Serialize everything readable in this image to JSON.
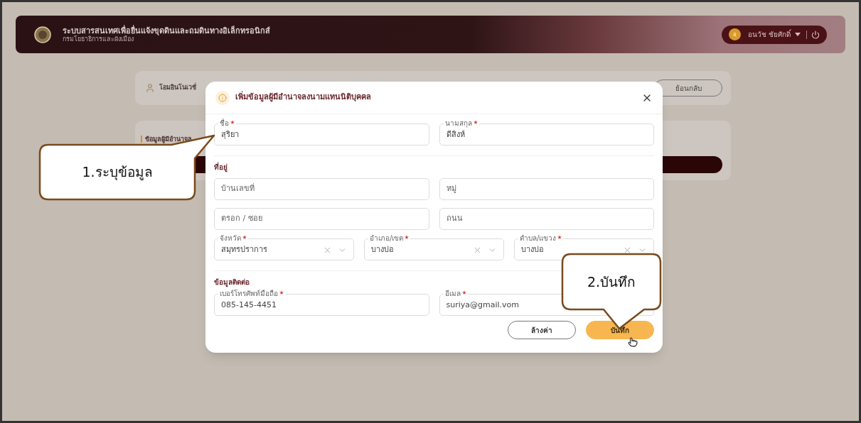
{
  "header": {
    "title": "ระบบสารสนเทศเพื่อยื่นแจ้งขุดดินและถมดินทางอิเล็กทรอนิกส์",
    "subtitle": "กรมโยธาธิการและผังเมือง",
    "user": {
      "initial": "อ",
      "name": "อนวัช ชัยศักดิ์"
    }
  },
  "company_card": {
    "name": "โอมอินโนเวชั่",
    "back_button": "ย้อนกลับ"
  },
  "section_card": {
    "title": "ข้อมูลผู้มีอำนาจล"
  },
  "dialog": {
    "title": "เพิ่มข้อมูลผู้มีอำนาจลงนามแทนนิติบุคคล",
    "name_fields": [
      {
        "label": "ชื่อ",
        "required": true,
        "value": "สุริยา"
      },
      {
        "label": "นามสกุล",
        "required": true,
        "value": "ดีสิงห์"
      }
    ],
    "address_title": "ที่อยู่",
    "address_fields": [
      {
        "placeholder": "บ้านเลขที่"
      },
      {
        "placeholder": "หมู่"
      },
      {
        "placeholder": "ตรอก / ซอย"
      },
      {
        "placeholder": "ถนน"
      }
    ],
    "location_selects": [
      {
        "label": "จังหวัด",
        "required": true,
        "value": "สมุทรปราการ"
      },
      {
        "label": "อำเภอ/เขต",
        "required": true,
        "value": "บางบ่อ"
      },
      {
        "label": "ตำบล/แขวง",
        "required": true,
        "value": "บางบ่อ"
      }
    ],
    "contact_title": "ข้อมูลติดต่อ",
    "contact_fields": [
      {
        "label": "เบอร์โทรศัพท์มือถือ",
        "required": true,
        "value": "085-145-4451"
      },
      {
        "label": "อีเมล",
        "required": true,
        "value": "suriya@gmail.vom"
      }
    ],
    "buttons": [
      {
        "label": "ล้างค่า",
        "kind": "outline"
      },
      {
        "label": "บันทึก",
        "kind": "primary"
      }
    ]
  },
  "callouts": [
    {
      "text": "1.ระบุข้อมูล"
    },
    {
      "text": "2.บันทึก"
    }
  ]
}
